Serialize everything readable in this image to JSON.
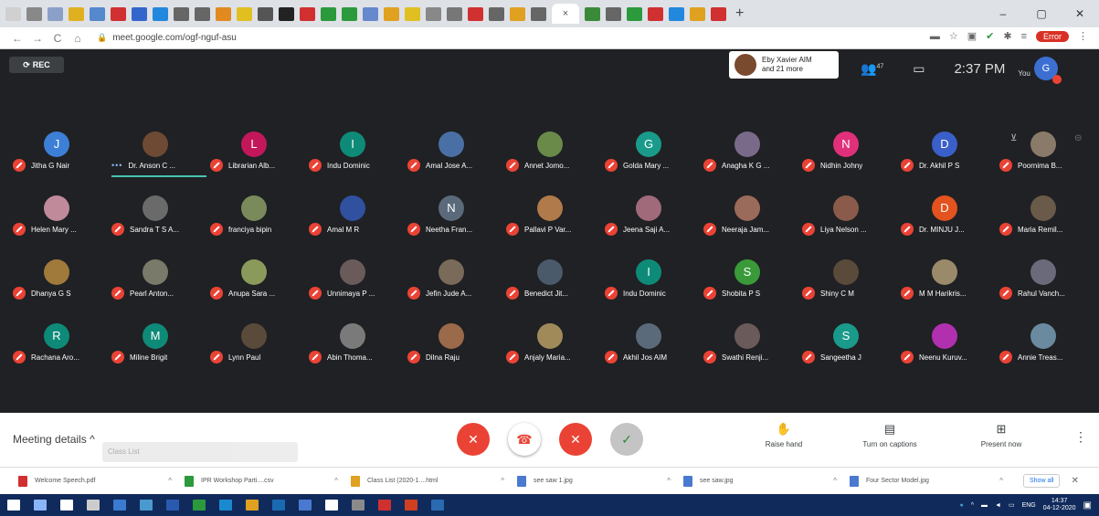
{
  "browser": {
    "tabs": [
      {
        "icon": "tab-icon",
        "color": "#d0d0d0"
      },
      {
        "icon": "tab-icon",
        "color": "#888888"
      },
      {
        "icon": "tab-icon",
        "color": "#8aa0c8"
      },
      {
        "icon": "tab-icon",
        "color": "#e0b020"
      },
      {
        "icon": "tab-icon",
        "color": "#5588cc"
      },
      {
        "icon": "tab-icon",
        "color": "#d03030"
      },
      {
        "icon": "tab-icon",
        "color": "#3366cc"
      },
      {
        "icon": "tab-icon",
        "color": "#2288dd"
      },
      {
        "icon": "tab-icon",
        "color": "#666666"
      },
      {
        "icon": "tab-icon",
        "color": "#666666"
      },
      {
        "icon": "tab-icon",
        "color": "#e08a20"
      },
      {
        "icon": "tab-icon",
        "color": "#e0c020"
      },
      {
        "icon": "tab-icon",
        "color": "#555555"
      },
      {
        "icon": "tab-icon",
        "color": "#222222"
      },
      {
        "icon": "tab-icon",
        "color": "#d03030"
      },
      {
        "icon": "tab-icon",
        "color": "#2b9a3c"
      },
      {
        "icon": "tab-icon",
        "color": "#2b9a3c"
      },
      {
        "icon": "tab-icon",
        "color": "#6688cc"
      },
      {
        "icon": "tab-icon",
        "color": "#e0a020"
      },
      {
        "icon": "tab-icon",
        "color": "#e0c020"
      },
      {
        "icon": "tab-icon",
        "color": "#888888"
      },
      {
        "icon": "tab-icon",
        "color": "#777777"
      },
      {
        "icon": "tab-icon",
        "color": "#d03030"
      },
      {
        "icon": "tab-icon",
        "color": "#666666"
      },
      {
        "icon": "tab-icon",
        "color": "#e0a020"
      },
      {
        "icon": "tab-icon",
        "color": "#666666"
      },
      {
        "icon": "tab-icon",
        "color": "#3a8a3a"
      },
      {
        "icon": "tab-icon",
        "color": "#666666"
      },
      {
        "icon": "tab-icon",
        "color": "#2b9a3c"
      },
      {
        "icon": "tab-icon",
        "color": "#d03030"
      },
      {
        "icon": "tab-icon",
        "color": "#2288dd"
      },
      {
        "icon": "tab-icon",
        "color": "#e0a020"
      },
      {
        "icon": "tab-icon",
        "color": "#d03030"
      }
    ],
    "active_tab_close": "×",
    "new_tab": "+",
    "window_controls": {
      "minimize": "–",
      "maximize": "▢",
      "close": "✕"
    },
    "url": "meet.google.com/ogf-nguf-asu",
    "nav": {
      "back": "←",
      "forward": "→",
      "reload": "C",
      "home": "⌂"
    },
    "profile_label": "Error"
  },
  "meet": {
    "rec_label": "REC",
    "presenter": {
      "line1": "Eby Xavier AIM",
      "line2": "and 21 more"
    },
    "participants_count": "47",
    "time": "2:37 PM",
    "you_label": "You",
    "self_initial": "G",
    "participants": [
      {
        "name": "Jitha G Nair",
        "initial": "J",
        "color": "#3d7fd6"
      },
      {
        "name": "Dr. Anson C ...",
        "initial": "",
        "color": "#6e4a34",
        "speaking": true
      },
      {
        "name": "Librarian Alb...",
        "initial": "L",
        "color": "#c2185b"
      },
      {
        "name": "Indu Dominic",
        "initial": "I",
        "color": "#0e8a78"
      },
      {
        "name": "Amal Jose A...",
        "initial": "",
        "color": "#4a6fa5"
      },
      {
        "name": "Annet Jomo...",
        "initial": "",
        "color": "#6a8a4a"
      },
      {
        "name": "Golda Mary ...",
        "initial": "G",
        "color": "#1a9a8a"
      },
      {
        "name": "Anagha K G ...",
        "initial": "",
        "color": "#7a6a8a"
      },
      {
        "name": "Nidhin Johny",
        "initial": "N",
        "color": "#e0307a"
      },
      {
        "name": "Dr. Akhil P S",
        "initial": "D",
        "color": "#3a5fc8"
      },
      {
        "name": "Poornima B...",
        "initial": "",
        "color": "#8a7a6a"
      },
      {
        "name": "Helen Mary ...",
        "initial": "",
        "color": "#c08a9a"
      },
      {
        "name": "Sandra T S A...",
        "initial": "",
        "color": "#6a6a6a"
      },
      {
        "name": "franciya bipin",
        "initial": "",
        "color": "#7a8a5a"
      },
      {
        "name": "Amal M R",
        "initial": "",
        "color": "#3050a0"
      },
      {
        "name": "Neetha Fran...",
        "initial": "N",
        "color": "#5a6a7a"
      },
      {
        "name": "Pallavi P Var...",
        "initial": "",
        "color": "#b07a4a"
      },
      {
        "name": "Jeena Saji A...",
        "initial": "",
        "color": "#a06a7a"
      },
      {
        "name": "Neeraja Jam...",
        "initial": "",
        "color": "#9a6a5a"
      },
      {
        "name": "Liya Nelson ...",
        "initial": "",
        "color": "#8a5a4a"
      },
      {
        "name": "Dr. MINJU J...",
        "initial": "D",
        "color": "#e2531f"
      },
      {
        "name": "Maria Remil...",
        "initial": "",
        "color": "#6a5a4a"
      },
      {
        "name": "Dhanya G S",
        "initial": "",
        "color": "#a07a3a"
      },
      {
        "name": "Pearl Anton...",
        "initial": "",
        "color": "#7a7a6a"
      },
      {
        "name": "Anupa Sara ...",
        "initial": "",
        "color": "#8a9a5a"
      },
      {
        "name": "Unnimaya P ...",
        "initial": "",
        "color": "#6a5a5a"
      },
      {
        "name": "Jefin Jude A...",
        "initial": "",
        "color": "#7a6a5a"
      },
      {
        "name": "Benedict Jit...",
        "initial": "",
        "color": "#4a5a6a"
      },
      {
        "name": "Indu Dominic",
        "initial": "I",
        "color": "#0e8a78"
      },
      {
        "name": "Shobita P S",
        "initial": "S",
        "color": "#3a9a3a"
      },
      {
        "name": "Shiny C M",
        "initial": "",
        "color": "#5a4a3a"
      },
      {
        "name": "M M Harikris...",
        "initial": "",
        "color": "#9a8a6a"
      },
      {
        "name": "Rahul Vanch...",
        "initial": "",
        "color": "#6a6a7a"
      },
      {
        "name": "Rachana Aro...",
        "initial": "R",
        "color": "#0e8a78"
      },
      {
        "name": "Miline Brigit",
        "initial": "M",
        "color": "#0e8a78"
      },
      {
        "name": "Lynn Paul",
        "initial": "",
        "color": "#5a4a3a"
      },
      {
        "name": "Abin Thoma...",
        "initial": "",
        "color": "#7a7a7a"
      },
      {
        "name": "Dilna Raju",
        "initial": "",
        "color": "#9a6a4a"
      },
      {
        "name": "Anjaly Maria...",
        "initial": "",
        "color": "#a08a5a"
      },
      {
        "name": "Akhil Jos AIM",
        "initial": "",
        "color": "#5a6a7a"
      },
      {
        "name": "Swathi Renji...",
        "initial": "",
        "color": "#6a5a5a"
      },
      {
        "name": "Sangeetha J",
        "initial": "S",
        "color": "#1a9a8a"
      },
      {
        "name": "Neenu Kuruv...",
        "initial": "",
        "color": "#b030b0"
      },
      {
        "name": "Annie Treas...",
        "initial": "",
        "color": "#6a8aa0"
      }
    ]
  },
  "controls": {
    "meeting_details": "Meeting details",
    "meeting_details_chevron": "^",
    "class_list_overlay": "Class List",
    "mic_icon": "✕",
    "hangup_icon": "☎",
    "camera_icon": "✕",
    "check_icon": "✓",
    "raise_hand_icon": "✋",
    "raise_hand": "Raise hand",
    "captions_icon": "▤",
    "captions": "Turn on captions",
    "present_icon": "⊞",
    "present": "Present now",
    "more": "⋮"
  },
  "downloads": {
    "items": [
      {
        "name": "Welcome Speech.pdf",
        "color": "#d03030"
      },
      {
        "name": "IPR Workshop Parti....csv",
        "color": "#2b9a3c"
      },
      {
        "name": "Class List (2020-1....html",
        "color": "#e0a020"
      },
      {
        "name": "see saw 1.jpg",
        "color": "#4a7ad0"
      },
      {
        "name": "see saw.jpg",
        "color": "#4a7ad0"
      },
      {
        "name": "Four Sector Model.jpg",
        "color": "#4a7ad0"
      }
    ],
    "caret": "^",
    "show_all": "Show all",
    "close": "✕"
  },
  "taskbar": {
    "icons": [
      {
        "color": "#ffffff"
      },
      {
        "color": "#8ab4f8"
      },
      {
        "color": "#ffffff"
      },
      {
        "color": "#cccccc"
      },
      {
        "color": "#3a7ad0"
      },
      {
        "color": "#4a9ad0"
      },
      {
        "color": "#2a5ab0"
      },
      {
        "color": "#2b9a3c"
      },
      {
        "color": "#1a8ad0"
      },
      {
        "color": "#e0a020"
      },
      {
        "color": "#1a6ab0"
      },
      {
        "color": "#4a7ad0"
      },
      {
        "color": "#ffffff"
      },
      {
        "color": "#8a8a8a"
      },
      {
        "color": "#d03030"
      },
      {
        "color": "#d04020"
      },
      {
        "color": "#2a6ab0"
      }
    ],
    "lang": "ENG",
    "time": "14:37",
    "date": "04-12-2020"
  }
}
